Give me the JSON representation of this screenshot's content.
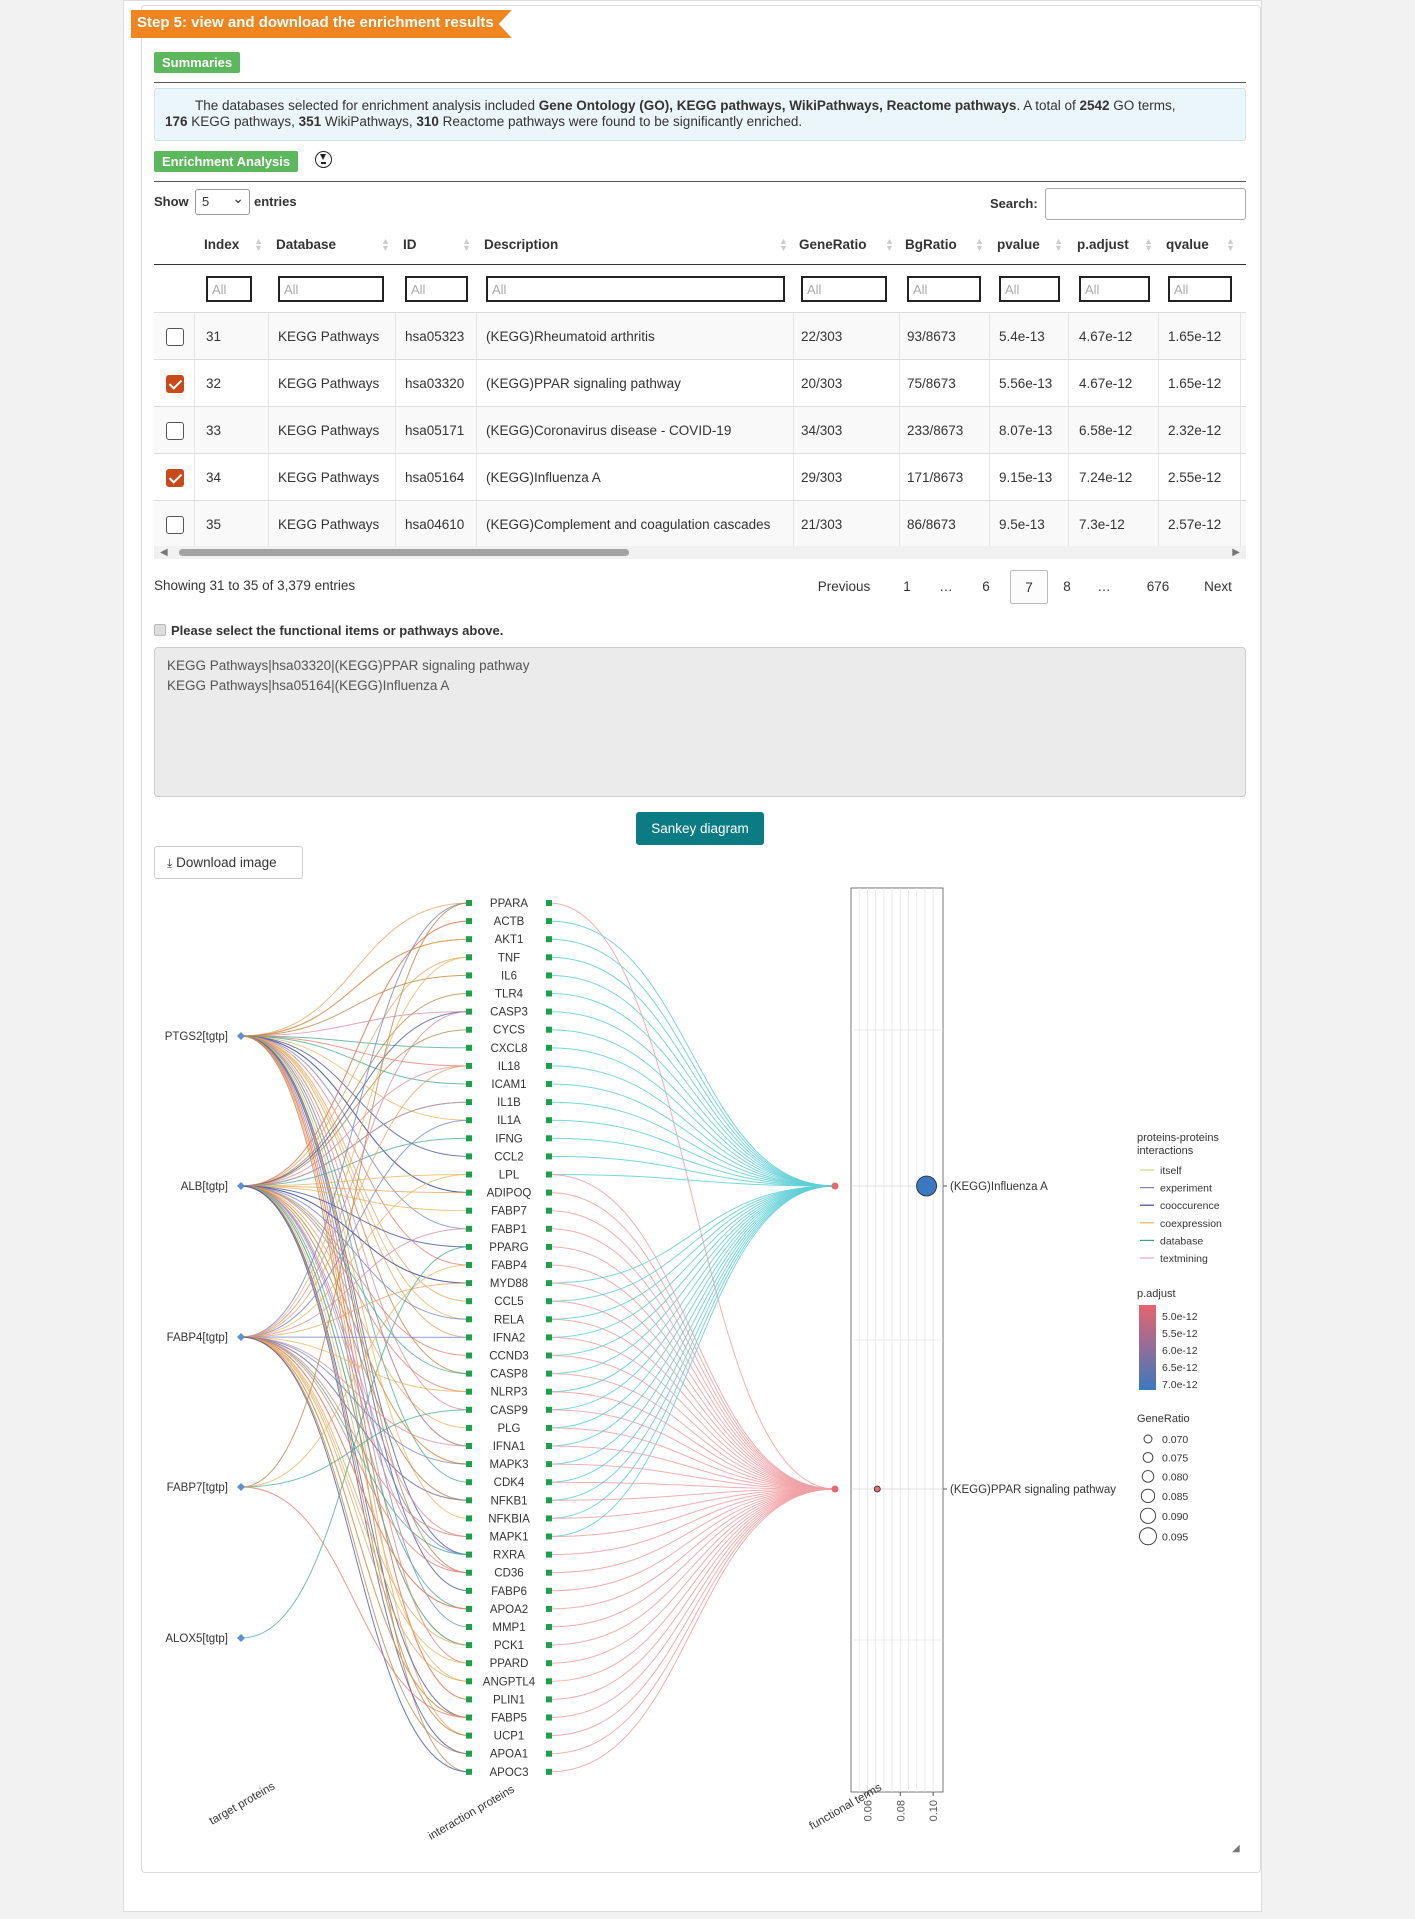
{
  "step_title": "Step 5: view and download the enrichment results",
  "summaries_label": "Summaries",
  "summary": {
    "p1": "The databases selected for enrichment analysis included ",
    "b1": "Gene Ontology (GO), KEGG pathways, WikiPathways, Reactome pathways",
    "p2": ". A total of ",
    "b2": "2542",
    "p3": " GO terms,",
    "b3": "176",
    "p4": " KEGG pathways, ",
    "b4": "351",
    "p5": " WikiPathways, ",
    "b5": "310",
    "p6": " Reactome pathways were found to be significantly enriched."
  },
  "enrichment_label": "Enrichment Analysis",
  "table": {
    "show_label": "Show",
    "entries_label": "entries",
    "page_length": "5",
    "search_label": "Search:",
    "filter_placeholder": "All",
    "columns": [
      "Index",
      "Database",
      "ID",
      "Description",
      "GeneRatio",
      "BgRatio",
      "pvalue",
      "p.adjust",
      "qvalue"
    ],
    "rows": [
      {
        "checked": false,
        "cells": [
          "31",
          "KEGG Pathways",
          "hsa05323",
          "(KEGG)Rheumatoid arthritis",
          "22/303",
          "93/8673",
          "5.4e-13",
          "4.67e-12",
          "1.65e-12"
        ]
      },
      {
        "checked": true,
        "cells": [
          "32",
          "KEGG Pathways",
          "hsa03320",
          "(KEGG)PPAR signaling pathway",
          "20/303",
          "75/8673",
          "5.56e-13",
          "4.67e-12",
          "1.65e-12"
        ]
      },
      {
        "checked": false,
        "cells": [
          "33",
          "KEGG Pathways",
          "hsa05171",
          "(KEGG)Coronavirus disease - COVID-19",
          "34/303",
          "233/8673",
          "8.07e-13",
          "6.58e-12",
          "2.32e-12"
        ]
      },
      {
        "checked": true,
        "cells": [
          "34",
          "KEGG Pathways",
          "hsa05164",
          "(KEGG)Influenza A",
          "29/303",
          "171/8673",
          "9.15e-13",
          "7.24e-12",
          "2.55e-12"
        ]
      },
      {
        "checked": false,
        "cells": [
          "35",
          "KEGG Pathways",
          "hsa04610",
          "(KEGG)Complement and coagulation cascades",
          "21/303",
          "86/8673",
          "9.5e-13",
          "7.3e-12",
          "2.57e-12"
        ]
      }
    ],
    "info": "Showing 31 to 35 of 3,379 entries",
    "pagination": [
      "Previous",
      "1",
      "…",
      "6",
      "7",
      "8",
      "…",
      "676",
      "Next"
    ],
    "current_page": "7"
  },
  "selection_label": "Please select the functional items or pathways above.",
  "selected_items": [
    "KEGG Pathways|hsa03320|(KEGG)PPAR signaling pathway",
    "KEGG Pathways|hsa05164|(KEGG)Influenza A"
  ],
  "sankey_button": "Sankey diagram",
  "download_button": "Download image",
  "chart_data": {
    "type": "sankey",
    "columns": [
      "target proteins",
      "interaction proteins",
      "functional terms"
    ],
    "target_proteins": [
      "PTGS2[tgtp]",
      "ALB[tgtp]",
      "FABP4[tgtp]",
      "FABP7[tgtp]",
      "ALOX5[tgtp]"
    ],
    "interaction_proteins": [
      "PPARA",
      "ACTB",
      "AKT1",
      "TNF",
      "IL6",
      "TLR4",
      "CASP3",
      "CYCS",
      "CXCL8",
      "IL18",
      "ICAM1",
      "IL1B",
      "IL1A",
      "IFNG",
      "CCL2",
      "LPL",
      "ADIPOQ",
      "FABP7",
      "FABP1",
      "PPARG",
      "FABP4",
      "MYD88",
      "CCL5",
      "RELA",
      "IFNA2",
      "CCND3",
      "CASP8",
      "NLRP3",
      "CASP9",
      "PLG",
      "IFNA1",
      "MAPK3",
      "CDK4",
      "NFKB1",
      "NFKBIA",
      "MAPK1",
      "RXRA",
      "CD36",
      "FABP6",
      "APOA2",
      "MMP1",
      "PCK1",
      "PPARD",
      "ANGPTL4",
      "PLIN1",
      "FABP5",
      "UCP1",
      "APOA1",
      "APOC3"
    ],
    "functional_terms": [
      "(KEGG)Influenza A",
      "(KEGG)PPAR signaling pathway"
    ],
    "dot_plot": {
      "x_ticks": [
        "0.06",
        "0.08",
        "0.10"
      ],
      "xlim": [
        0.05,
        0.106
      ],
      "points": [
        {
          "term": "(KEGG)Influenza A",
          "gene_ratio": 0.096,
          "p_adjust": 7.24e-12
        },
        {
          "term": "(KEGG)PPAR signaling pathway",
          "gene_ratio": 0.066,
          "p_adjust": 4.67e-12
        }
      ]
    },
    "legend_ppi": {
      "title": [
        "proteins-proteins",
        "interactions"
      ],
      "items": [
        {
          "label": "itself",
          "color": "#c8d88a"
        },
        {
          "label": "experiment",
          "color": "#7b7fbf"
        },
        {
          "label": "cooccurence",
          "color": "#3b4a8c"
        },
        {
          "label": "coexpression",
          "color": "#e8b45a"
        },
        {
          "label": "database",
          "color": "#3aa38a"
        },
        {
          "label": "textmining",
          "color": "#e0a8c0"
        }
      ]
    },
    "legend_padjust": {
      "title": "p.adjust",
      "ticks": [
        "5.0e-12",
        "5.5e-12",
        "6.0e-12",
        "6.5e-12",
        "7.0e-12"
      ],
      "low_color": "#e8646e",
      "high_color": "#3a78c2"
    },
    "legend_generatio": {
      "title": "GeneRatio",
      "ticks": [
        "0.070",
        "0.075",
        "0.080",
        "0.085",
        "0.090",
        "0.095"
      ]
    }
  },
  "colors": {
    "ribbon": "#f0851f",
    "tag": "#5cb85c",
    "checked": "#c9491b",
    "sankey_button": "#0b7c83",
    "link_cyan": "#5fd0d6",
    "link_pink": "#f0a0a4",
    "node_green": "#1aa14a",
    "node_blue": "#5b8fd6"
  }
}
